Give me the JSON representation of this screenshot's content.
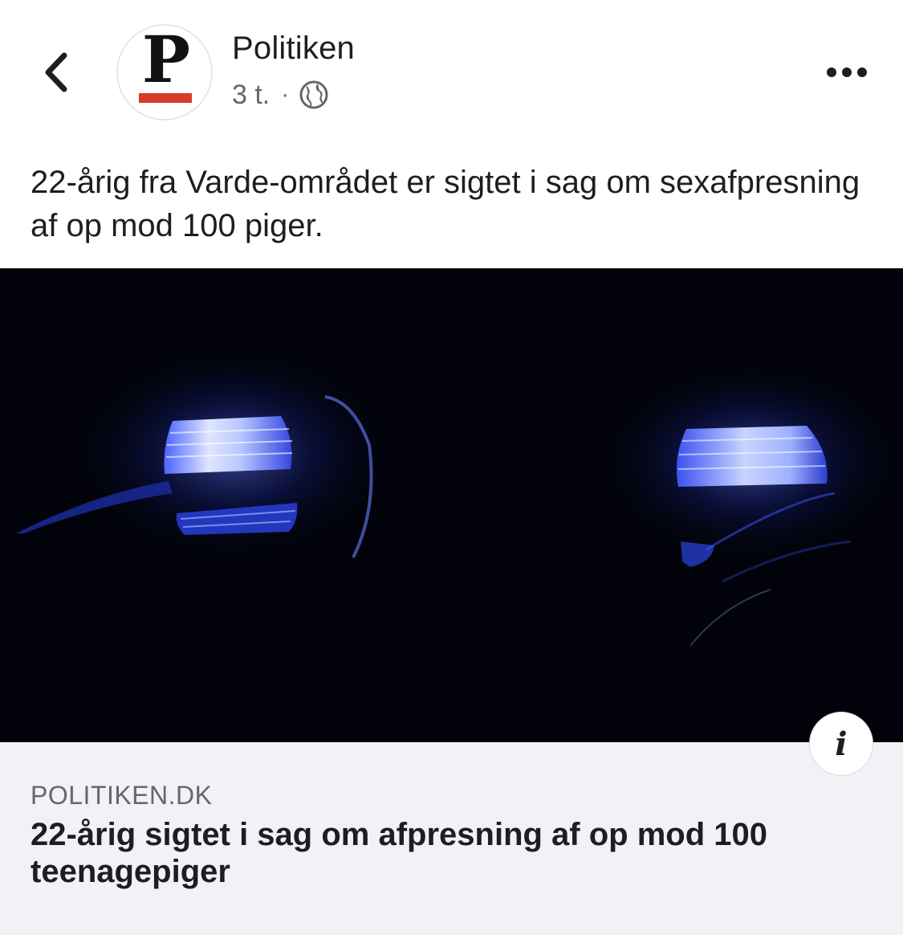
{
  "post": {
    "page_name": "Politiken",
    "time": "3 t.",
    "separator": "·",
    "privacy_icon": "globe-icon",
    "text": "22-årig fra Varde-området er sigtet i sag om sexafpresning af op mod 100 piger."
  },
  "header": {
    "back_icon": "chevron-left-icon",
    "more_icon": "more-dots-icon",
    "avatar_logo_letter": "P"
  },
  "link_preview": {
    "info_label": "i",
    "domain": "POLITIKEN.DK",
    "title": "22-årig sigtet i sag om afpresning af op mod 100 teenagepiger"
  },
  "colors": {
    "logo_red": "#d93a2b",
    "siren_blue": "#3a55ff"
  }
}
